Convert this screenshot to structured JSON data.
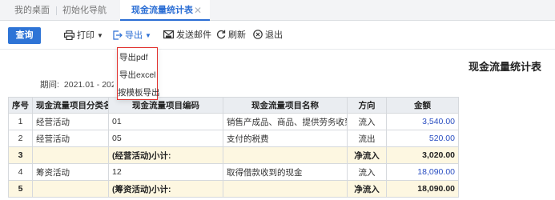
{
  "tabs": [
    {
      "label": "我的桌面"
    },
    {
      "label": "初始化导航"
    },
    {
      "label": "现金流量统计表",
      "close": "✕"
    }
  ],
  "toolbar": {
    "query_label": "查询",
    "print_label": "打印",
    "export_label": "导出",
    "email_label": "发送邮件",
    "refresh_label": "刷新",
    "exit_label": "退出"
  },
  "export_menu": {
    "items": [
      "导出pdf",
      "导出excel",
      "按模板导出"
    ]
  },
  "report": {
    "title": "现金流量统计表",
    "period_label": "期间:",
    "period_value": "2021.01 - 2021.0"
  },
  "table": {
    "headers": [
      "序号",
      "现金流量项目分类名",
      "现金流量项目编码",
      "现金流量项目名称",
      "方向",
      "金额"
    ],
    "rows": [
      {
        "no": "1",
        "category": "经营活动",
        "code": "01",
        "name": "销售产成品、商品、提供劳务收到的...",
        "direction": "流入",
        "amount": "3,540.00",
        "subtotal": false
      },
      {
        "no": "2",
        "category": "经营活动",
        "code": "05",
        "name": "支付的税费",
        "direction": "流出",
        "amount": "520.00",
        "subtotal": false
      },
      {
        "no": "3",
        "category": "",
        "code": "(经营活动)小计:",
        "name": "",
        "direction": "净流入",
        "amount": "3,020.00",
        "subtotal": true
      },
      {
        "no": "4",
        "category": "筹资活动",
        "code": "12",
        "name": "取得借款收到的现金",
        "direction": "流入",
        "amount": "18,090.00",
        "subtotal": false
      },
      {
        "no": "5",
        "category": "",
        "code": "(筹资活动)小计:",
        "name": "",
        "direction": "净流入",
        "amount": "18,090.00",
        "subtotal": true
      }
    ]
  },
  "colors": {
    "accent": "#2e74d6",
    "highlight_border": "#e2312e",
    "subtotal_bg": "#fdf7e1"
  }
}
